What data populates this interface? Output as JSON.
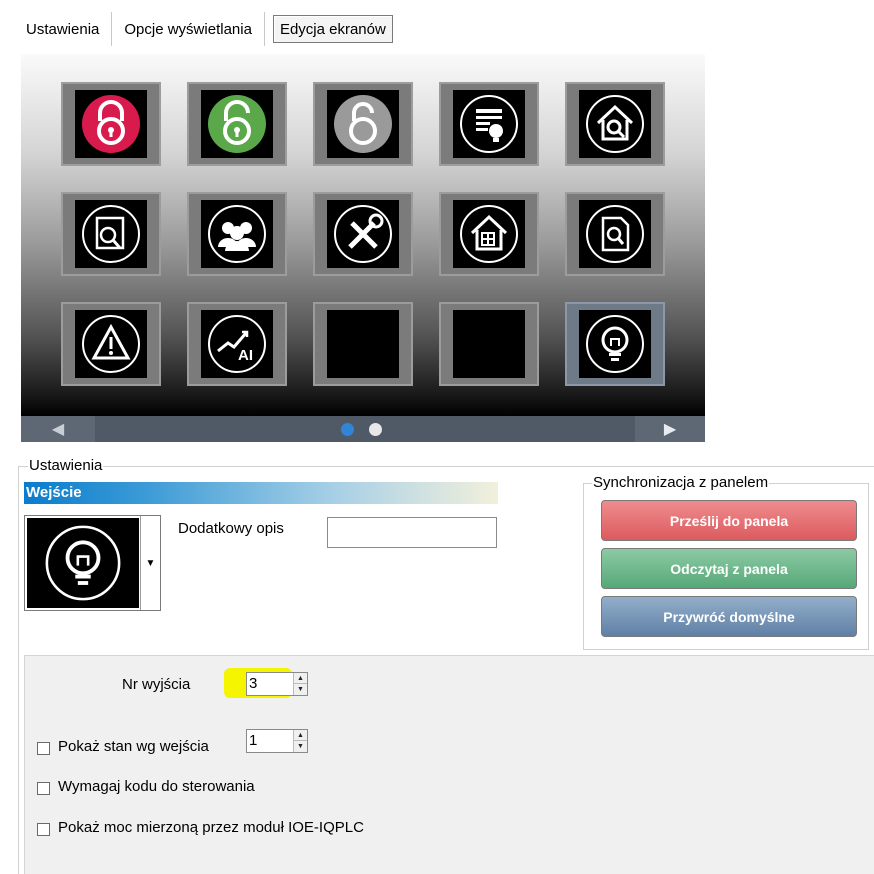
{
  "tabs": [
    {
      "label": "Ustawienia"
    },
    {
      "label": "Opcje wyświetlania"
    },
    {
      "label": "Edycja  ekranów"
    }
  ],
  "screen": {
    "tiles": [
      {
        "icon": "red-padlock-closed-icon"
      },
      {
        "icon": "green-padlock-open-icon"
      },
      {
        "icon": "gray-padlock-icon"
      },
      {
        "icon": "list-lightbulb-icon"
      },
      {
        "icon": "home-search-icon"
      },
      {
        "icon": "document-search-icon"
      },
      {
        "icon": "users-group-icon"
      },
      {
        "icon": "tools-icon"
      },
      {
        "icon": "home-window-icon"
      },
      {
        "icon": "file-search-icon"
      },
      {
        "icon": "warning-icon"
      },
      {
        "icon": "analog-input-chart-icon"
      },
      {
        "icon": "empty-tile"
      },
      {
        "icon": "empty-tile"
      },
      {
        "icon": "lightbulb-icon"
      }
    ],
    "nav_left_icon": "◀",
    "nav_right_icon": "▶",
    "page_dots": 2,
    "active_page": 1
  },
  "settings": {
    "group_label": "Ustawienia",
    "section_title": "Wejście",
    "selected_icon": "lightbulb-icon",
    "extra_desc_label": "Dodatkowy opis",
    "extra_desc_value": ""
  },
  "sync": {
    "group_label": "Synchronizacja z panelem",
    "send_label": "Prześlij do panela",
    "read_label": "Odczytaj z panela",
    "restore_label": "Przywróć domyślne",
    "send_color": "#e05a5e",
    "read_color": "#56a878",
    "restore_color": "#5f80a6"
  },
  "output": {
    "label": "Nr wyjścia",
    "value": "3",
    "highlight_color": "#f5f500"
  },
  "options": {
    "show_state_label": "Pokaż stan wg wejścia",
    "show_state_value": "1",
    "show_state_checked": false,
    "require_code_label": "Wymagaj kodu do sterowania",
    "require_code_checked": false,
    "show_power_label": "Pokaż moc mierzoną przez moduł IOE-IQPLC",
    "show_power_checked": false
  }
}
